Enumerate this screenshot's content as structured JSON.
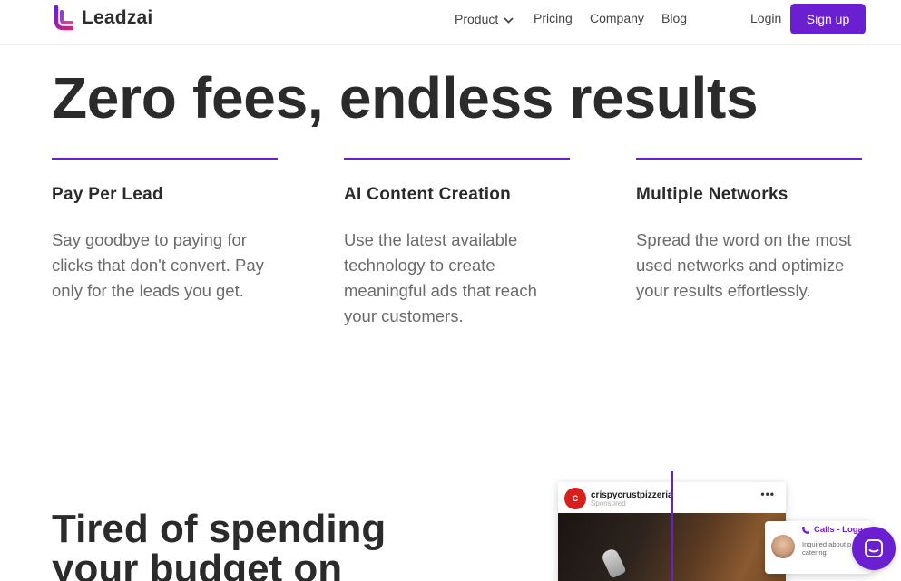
{
  "nav": {
    "brand": "Leadzai",
    "product": "Product",
    "pricing": "Pricing",
    "company": "Company",
    "blog": "Blog",
    "login": "Login",
    "signup": "Sign up"
  },
  "hero": {
    "title": "Zero fees, endless results"
  },
  "features": [
    {
      "title": "Pay Per Lead",
      "text": "Say goodbye to paying for clicks that don't convert. Pay only for the leads you get."
    },
    {
      "title": "AI Content Creation",
      "text": "Use the latest available technology to create meaningful ads that reach your customers."
    },
    {
      "title": "Multiple Networks",
      "text": "Spread the word on the most used networks and optimize your results effortlessly."
    }
  ],
  "section2": {
    "line1": "Tired of spending",
    "line2": "your budget on"
  },
  "ad_mockup": {
    "account": "crispycrustpizzeria",
    "sponsored": "Sponsored",
    "more": "•••"
  },
  "calls_card": {
    "title": "Calls - Loga",
    "subtitle": "Inquired about p catering"
  },
  "colors": {
    "accent": "#6a1fd1",
    "heading": "#2b2b2b",
    "body": "#6b6b6b"
  },
  "icons": {
    "logo": "leadzai-logo-icon",
    "chevron": "chevron-down-icon",
    "phone": "phone-icon",
    "chat": "chat-bubble-icon"
  }
}
